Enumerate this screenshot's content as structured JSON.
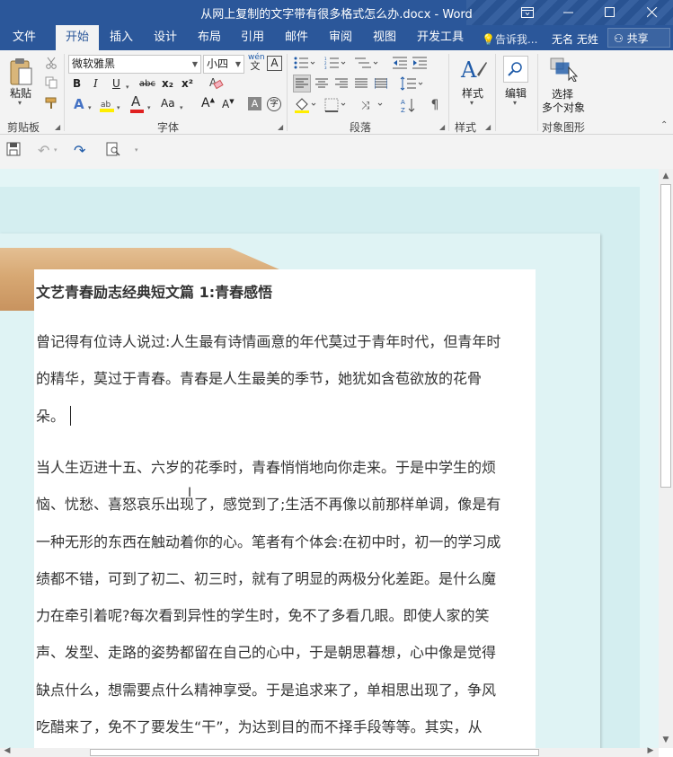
{
  "window": {
    "title": "从网上复制的文字带有很多格式怎么办.docx - Word",
    "ribbon_display_icon": "ribbon-display-icon",
    "minimize_icon": "minimize-icon",
    "maximize_icon": "maximize-icon",
    "close_icon": "close-icon"
  },
  "tabs": [
    {
      "label": "文件"
    },
    {
      "label": "开始"
    },
    {
      "label": "插入"
    },
    {
      "label": "设计"
    },
    {
      "label": "布局"
    },
    {
      "label": "引用"
    },
    {
      "label": "邮件"
    },
    {
      "label": "审阅"
    },
    {
      "label": "视图"
    },
    {
      "label": "开发工具"
    }
  ],
  "active_tab": "开始",
  "tell_me": "告诉我...",
  "user": "无名 无姓",
  "share": "共享",
  "ribbon": {
    "clipboard": {
      "label": "剪贴板",
      "paste": "粘贴"
    },
    "font": {
      "label": "字体",
      "font_name": "微软雅黑",
      "font_size": "小四",
      "wen": "wén",
      "wen_char": "文",
      "A_box": "A",
      "bold": "B",
      "italic": "I",
      "underline": "U",
      "strike": "abc",
      "sub": "x₂",
      "sup": "x²",
      "A_effect": "A",
      "A_color": "A",
      "case": "Aa",
      "grow": "A",
      "shrink": "A",
      "shade_A": "A",
      "enclose": "字"
    },
    "paragraph": {
      "label": "段落"
    },
    "styles": {
      "label": "样式",
      "button": "样式"
    },
    "editing": {
      "button": "编辑"
    },
    "object": {
      "label": "对象图形",
      "button_line1": "选择",
      "button_line2": "多个对象"
    }
  },
  "accent": "#2b579a",
  "doc": {
    "heading": "文艺青春励志经典短文篇 1:青春感悟",
    "para1_lines": [
      "曾记得有位诗人说过:人生最有诗情画意的年代莫过于青年时代，但青年时",
      "的精华，莫过于青春。青春是人生最美的季节，她犹如含苞欲放的花骨",
      "朵。"
    ],
    "para2_lines": [
      "当人生迈进十五、六岁的花季时，青春悄悄地向你走来。于是中学生的烦",
      "恼、忧愁、喜怒哀乐出现了，感觉到了;生活不再像以前那样单调，像是有",
      "一种无形的东西在触动着你的心。笔者有个体会:在初中时，初一的学习成",
      "绩都不错，可到了初二、初三时，就有了明显的两极分化差距。是什么魔",
      "力在牵引着呢?每次看到异性的学生时，免不了多看几眼。即使人家的笑",
      "声、发型、走路的姿势都留在自己的心中，于是朝思暮想，心中像是觉得",
      "缺点什么，想需要点什么精神享受。于是追求来了，单相思出现了，争风",
      "吃醋来了，免不了要发生“干”，为达到目的而不择手段等等。其实，从"
    ]
  }
}
